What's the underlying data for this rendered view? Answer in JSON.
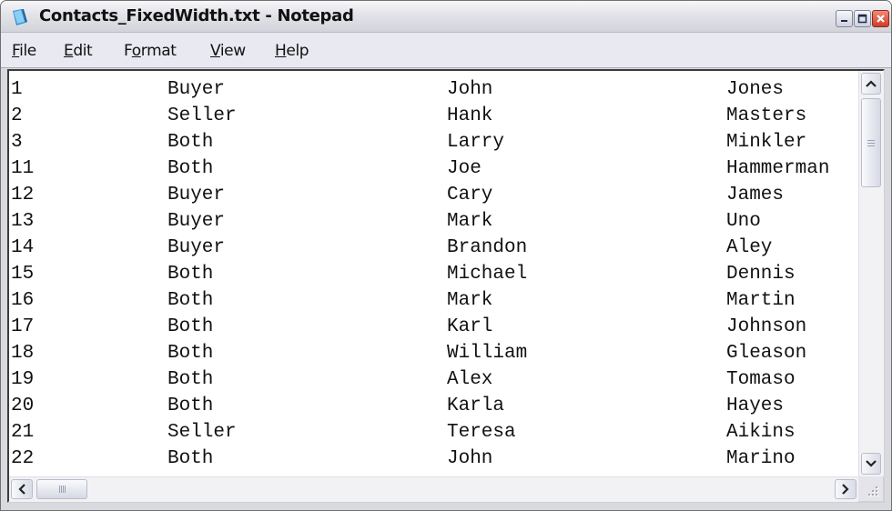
{
  "window": {
    "title": "Contacts_FixedWidth.txt - Notepad",
    "app_icon": "notepad-icon",
    "controls": {
      "minimize": "minimize-icon",
      "maximize": "maximize-icon",
      "close": "close-icon"
    }
  },
  "menu": {
    "items": [
      {
        "label": "File",
        "mnemonic": "F"
      },
      {
        "label": "Edit",
        "mnemonic": "E"
      },
      {
        "label": "Format",
        "mnemonic": "o"
      },
      {
        "label": "View",
        "mnemonic": "V"
      },
      {
        "label": "Help",
        "mnemonic": "H"
      }
    ]
  },
  "document": {
    "lines": [
      [
        "1",
        "Buyer",
        "John",
        "Jones"
      ],
      [
        "2",
        "Seller",
        "Hank",
        "Masters"
      ],
      [
        "3",
        "Both",
        "Larry",
        "Minkler"
      ],
      [
        "11",
        "Both",
        "Joe",
        "Hammerman"
      ],
      [
        "12",
        "Buyer",
        "Cary",
        "James"
      ],
      [
        "13",
        "Buyer",
        "Mark",
        "Uno"
      ],
      [
        "14",
        "Buyer",
        "Brandon",
        "Aley"
      ],
      [
        "15",
        "Both",
        "Michael",
        "Dennis"
      ],
      [
        "16",
        "Both",
        "Mark",
        "Martin"
      ],
      [
        "17",
        "Both",
        "Karl",
        "Johnson"
      ],
      [
        "18",
        "Both",
        "William",
        "Gleason"
      ],
      [
        "19",
        "Both",
        "Alex",
        "Tomaso"
      ],
      [
        "20",
        "Both",
        "Karla",
        "Hayes"
      ],
      [
        "21",
        "Seller",
        "Teresa",
        "Aikins"
      ],
      [
        "22",
        "Both",
        "John",
        "Marino"
      ]
    ]
  },
  "scrollbars": {
    "vertical": {
      "up_glyph": "⌃",
      "down_glyph": "⌄",
      "grip_glyph": "≡"
    },
    "horizontal": {
      "left_glyph": "<",
      "right_glyph": ">",
      "grip_glyph": "||||"
    }
  }
}
